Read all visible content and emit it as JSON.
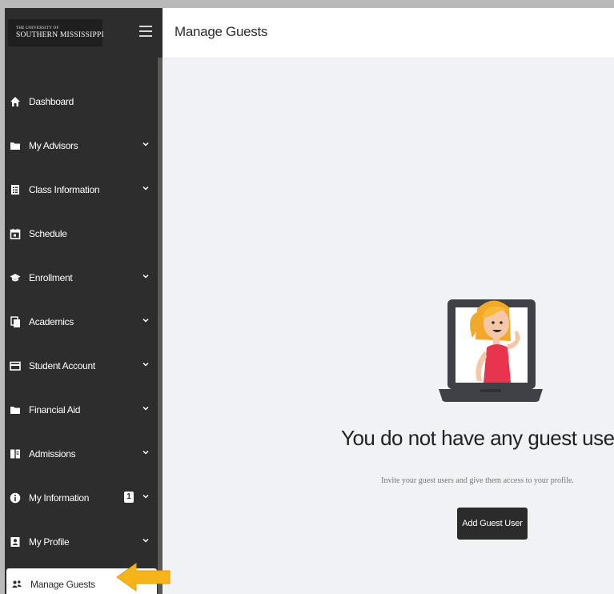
{
  "brand": {
    "logo_small": "THE UNIVERSITY OF",
    "logo_big": "SOUTHERN MISSISSIPPI"
  },
  "header": {
    "title": "Manage Guests"
  },
  "sidebar": {
    "items": [
      {
        "label": "Dashboard",
        "icon": "home-icon",
        "chevron": false
      },
      {
        "label": "My Advisors",
        "icon": "folder-icon",
        "chevron": true
      },
      {
        "label": "Class Information",
        "icon": "document-list-icon",
        "chevron": true
      },
      {
        "label": "Schedule",
        "icon": "calendar-icon",
        "chevron": false
      },
      {
        "label": "Enrollment",
        "icon": "graduation-cap-icon",
        "chevron": true
      },
      {
        "label": "Academics",
        "icon": "copy-document-icon",
        "chevron": true
      },
      {
        "label": "Student Account",
        "icon": "credit-card-icon",
        "chevron": true
      },
      {
        "label": "Financial Aid",
        "icon": "folder-icon",
        "chevron": true
      },
      {
        "label": "Admissions",
        "icon": "book-icon",
        "chevron": true
      },
      {
        "label": "My Information",
        "icon": "info-icon",
        "chevron": true,
        "badge": "1"
      },
      {
        "label": "My Profile",
        "icon": "profile-card-icon",
        "chevron": true
      },
      {
        "label": "Manage Guests",
        "icon": "users-icon",
        "chevron": false,
        "active": true
      }
    ]
  },
  "empty_state": {
    "title": "You do not have any guest users",
    "description": "Invite your guest users and give them access to your profile.",
    "button_label": "Add Guest User"
  },
  "colors": {
    "sidebar_bg": "#2d2d2d",
    "content_bg": "#f1f2f5",
    "accent_arrow": "#f4b41a",
    "button_bg": "#2b2b2b"
  }
}
